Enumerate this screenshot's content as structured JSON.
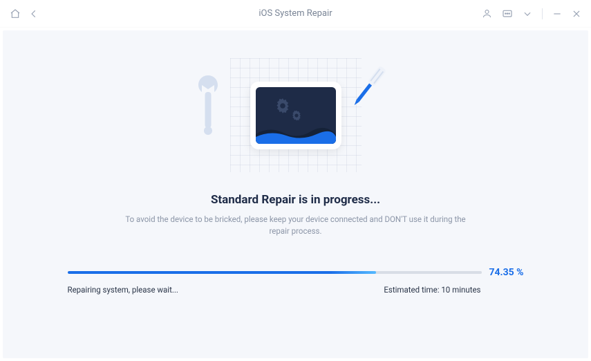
{
  "titlebar": {
    "title": "iOS System Repair"
  },
  "main": {
    "heading": "Standard Repair is in progress...",
    "subtext": "To avoid the device to be bricked, please keep your device connected and DON'T use it during the repair process."
  },
  "progress": {
    "percent_value": 74.35,
    "percent_label": "74.35 %",
    "fill_width": "74.35%",
    "status_text": "Repairing system, please wait...",
    "estimated_time_label": "Estimated time: 10 minutes"
  },
  "colors": {
    "accent": "#1a6ee8",
    "dark_navy": "#1e2b47",
    "muted": "#8b95a7"
  }
}
